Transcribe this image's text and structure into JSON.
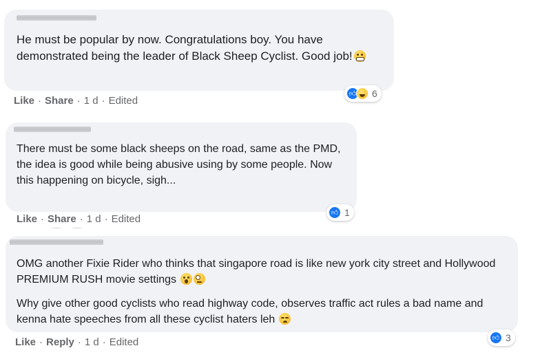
{
  "comments": [
    {
      "text": "He must be popular by now. Congratulations boy. You have demonstrated being the leader of Black Sheep Cyclist. Good job!",
      "emoji": "grimacing-emoji",
      "actions": [
        "Like",
        "Share"
      ],
      "time": "1 d",
      "edited": "Edited",
      "reaction_icons": [
        "like-icon",
        "haha-icon"
      ],
      "reaction_count": "6"
    },
    {
      "text": "There must be some black sheeps on the road, same as the PMD, the idea is good while being abusive using by some people. Now this happening on bicycle, sigh...",
      "actions": [
        "Like",
        "Share"
      ],
      "time": "1 d",
      "edited": "Edited",
      "reaction_icons": [
        "like-icon"
      ],
      "reaction_count": "1"
    },
    {
      "text_p1": "OMG another Fixie Rider who thinks that singapore road is like new york city street and Hollywood PREMIUM RUSH movie settings",
      "text_p2": "Why give other good cyclists who read highway code, observes traffic act rules a bad name and kenna hate speeches from all these cyclist haters leh",
      "emojis_p1": [
        "astonished-emoji",
        "face-with-rolling-eyes-emoji"
      ],
      "emoji_p2": "disappointed-emoji",
      "actions": [
        "Like",
        "Reply"
      ],
      "time": "1 d",
      "edited": "Edited",
      "reaction_icons": [
        "like-icon"
      ],
      "reaction_count": "3"
    }
  ],
  "colors": {
    "bubble": "#f0f2f5",
    "meta_text": "#65676b",
    "like_blue": "#1877f2"
  },
  "sep": "·"
}
